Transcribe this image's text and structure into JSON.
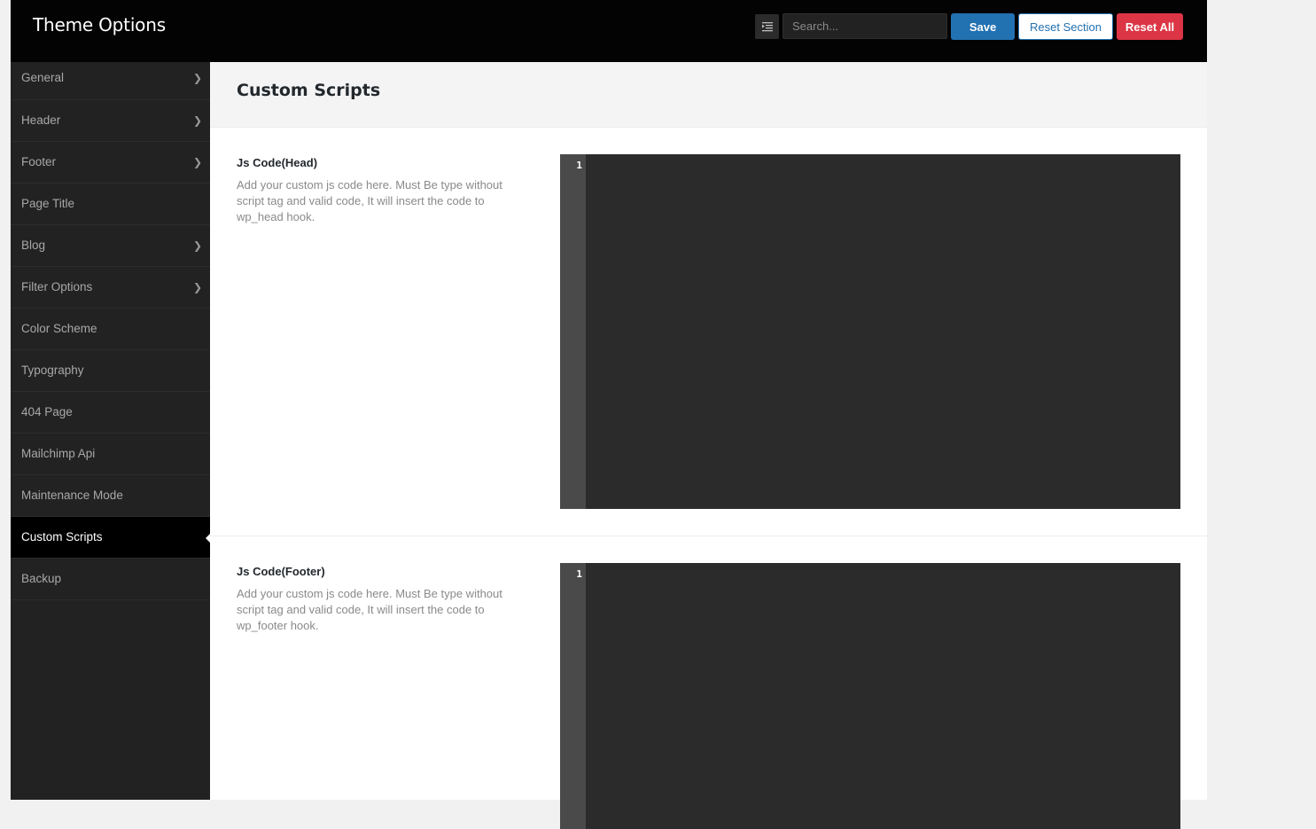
{
  "header": {
    "title": "Theme Options",
    "search_placeholder": "Search...",
    "save_label": "Save",
    "reset_section_label": "Reset Section",
    "reset_all_label": "Reset All"
  },
  "sidebar": {
    "items": [
      {
        "label": "General",
        "has_children": true,
        "active": false
      },
      {
        "label": "Header",
        "has_children": true,
        "active": false
      },
      {
        "label": "Footer",
        "has_children": true,
        "active": false
      },
      {
        "label": "Page Title",
        "has_children": false,
        "active": false
      },
      {
        "label": "Blog",
        "has_children": true,
        "active": false
      },
      {
        "label": "Filter Options",
        "has_children": true,
        "active": false
      },
      {
        "label": "Color Scheme",
        "has_children": false,
        "active": false
      },
      {
        "label": "Typography",
        "has_children": false,
        "active": false
      },
      {
        "label": "404 Page",
        "has_children": false,
        "active": false
      },
      {
        "label": "Mailchimp Api",
        "has_children": false,
        "active": false
      },
      {
        "label": "Maintenance Mode",
        "has_children": false,
        "active": false
      },
      {
        "label": "Custom Scripts",
        "has_children": false,
        "active": true
      },
      {
        "label": "Backup",
        "has_children": false,
        "active": false
      }
    ]
  },
  "main": {
    "section_title": "Custom Scripts",
    "fields": [
      {
        "label": "Js Code(Head)",
        "description": "Add your custom js code here. Must Be type without script tag and valid code, It will insert the code to wp_head hook.",
        "line_number": "1"
      },
      {
        "label": "Js Code(Footer)",
        "description": "Add your custom js code here. Must Be type without script tag and valid code, It will insert the code to wp_footer hook.",
        "line_number": "1"
      }
    ]
  },
  "colors": {
    "header_bg": "#030303",
    "sidebar_bg": "#222222",
    "primary": "#2271b1",
    "danger": "#dc3545",
    "editor_bg": "#2b2b2b"
  },
  "icons": {
    "expand": "expand-collapse-icon",
    "chevron": "chevron-right-icon"
  }
}
